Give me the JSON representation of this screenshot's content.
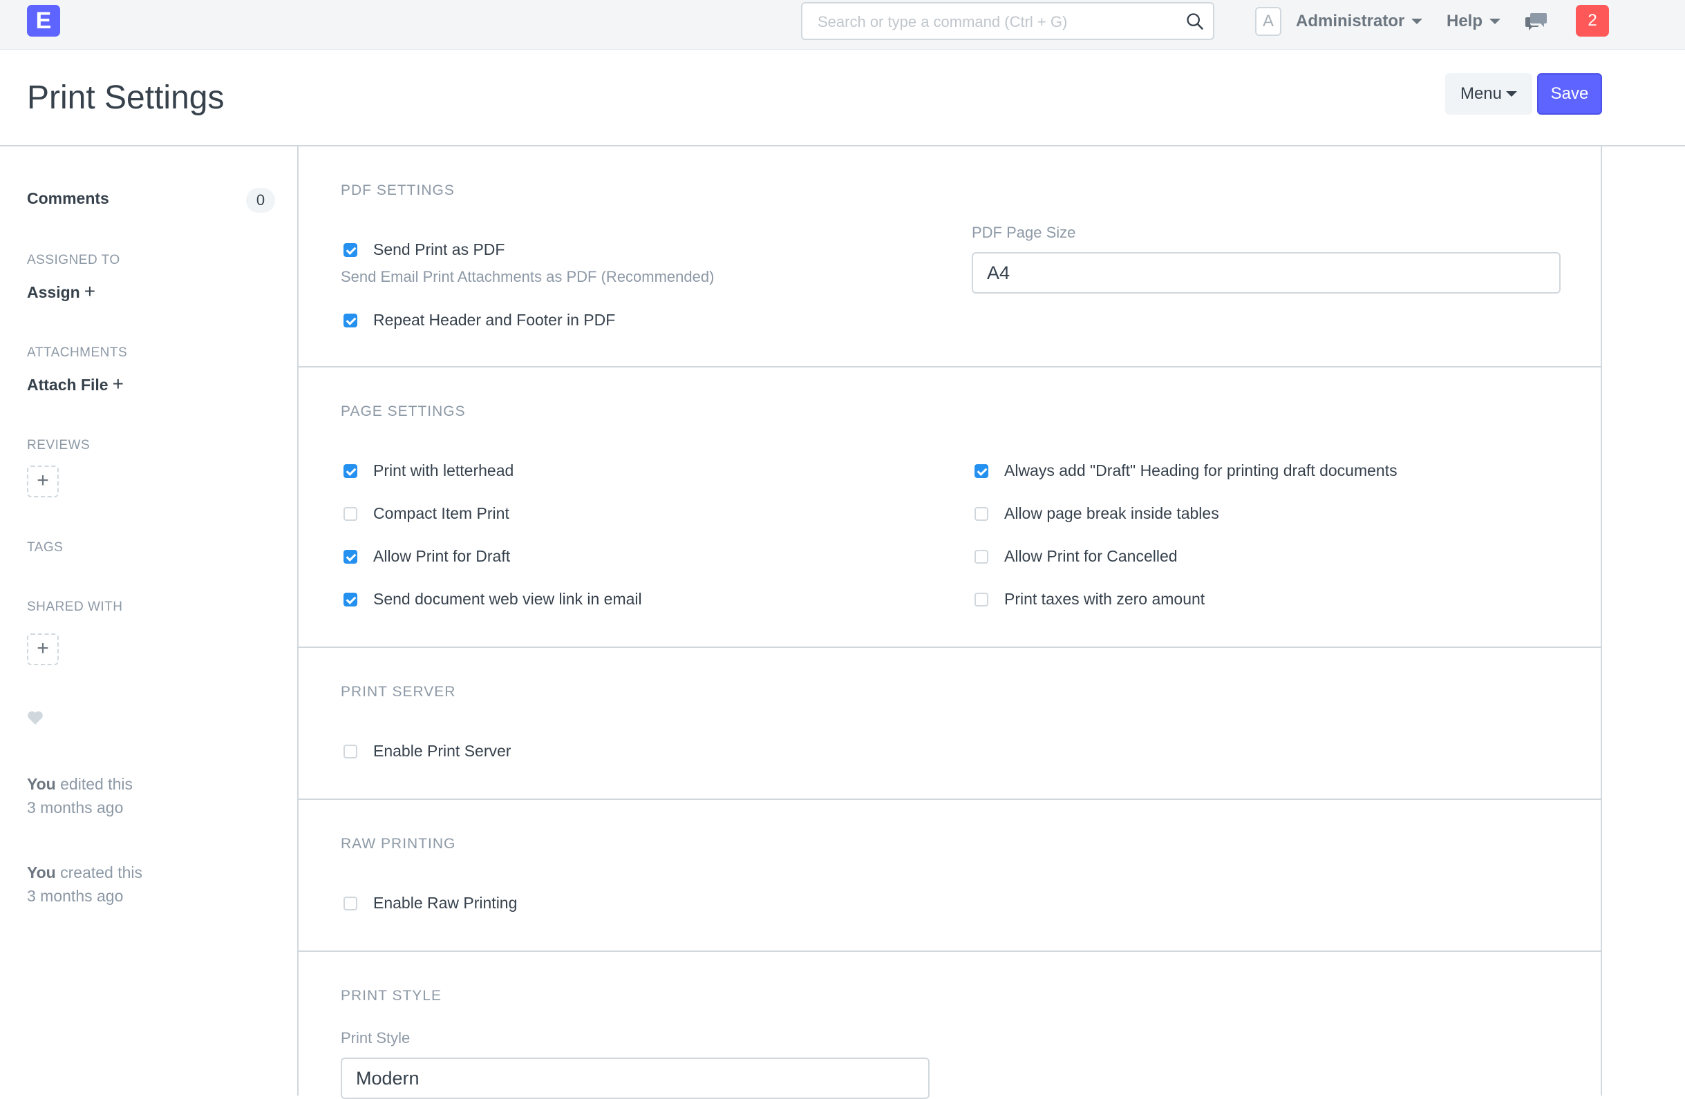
{
  "navbar": {
    "logo_letter": "E",
    "search_placeholder": "Search or type a command (Ctrl + G)",
    "avatar_letter": "A",
    "user_label": "Administrator",
    "help_label": "Help",
    "notification_count": "2"
  },
  "page": {
    "title": "Print Settings",
    "menu_label": "Menu",
    "save_label": "Save"
  },
  "sidebar": {
    "comments_label": "Comments",
    "comments_count": "0",
    "assigned_to_label": "ASSIGNED TO",
    "assign_label": "Assign",
    "attachments_label": "ATTACHMENTS",
    "attach_file_label": "Attach File",
    "reviews_label": "REVIEWS",
    "tags_label": "TAGS",
    "shared_with_label": "SHARED WITH",
    "activity": [
      {
        "actor": "You",
        "action": " edited this",
        "time": "3 months ago"
      },
      {
        "actor": "You",
        "action": " created this",
        "time": "3 months ago"
      }
    ]
  },
  "sections": {
    "pdf_settings": {
      "title": "PDF Settings",
      "send_print_as_pdf": {
        "label": "Send Print as PDF",
        "checked": true,
        "description": "Send Email Print Attachments as PDF (Recommended)"
      },
      "repeat_header_footer": {
        "label": "Repeat Header and Footer in PDF",
        "checked": true
      },
      "pdf_page_size": {
        "label": "PDF Page Size",
        "value": "A4"
      }
    },
    "page_settings": {
      "title": "Page Settings",
      "left": [
        {
          "label": "Print with letterhead",
          "checked": true
        },
        {
          "label": "Compact Item Print",
          "checked": false
        },
        {
          "label": "Allow Print for Draft",
          "checked": true
        },
        {
          "label": "Send document web view link in email",
          "checked": true
        }
      ],
      "right": [
        {
          "label": "Always add \"Draft\" Heading for printing draft documents",
          "checked": true
        },
        {
          "label": "Allow page break inside tables",
          "checked": false
        },
        {
          "label": "Allow Print for Cancelled",
          "checked": false
        },
        {
          "label": "Print taxes with zero amount",
          "checked": false
        }
      ]
    },
    "print_server": {
      "title": "Print Server",
      "enable_print_server": {
        "label": "Enable Print Server",
        "checked": false
      }
    },
    "raw_printing": {
      "title": "Raw Printing",
      "enable_raw_printing": {
        "label": "Enable Raw Printing",
        "checked": false
      }
    },
    "print_style": {
      "title": "Print Style",
      "field_label": "Print Style",
      "value": "Modern"
    }
  }
}
